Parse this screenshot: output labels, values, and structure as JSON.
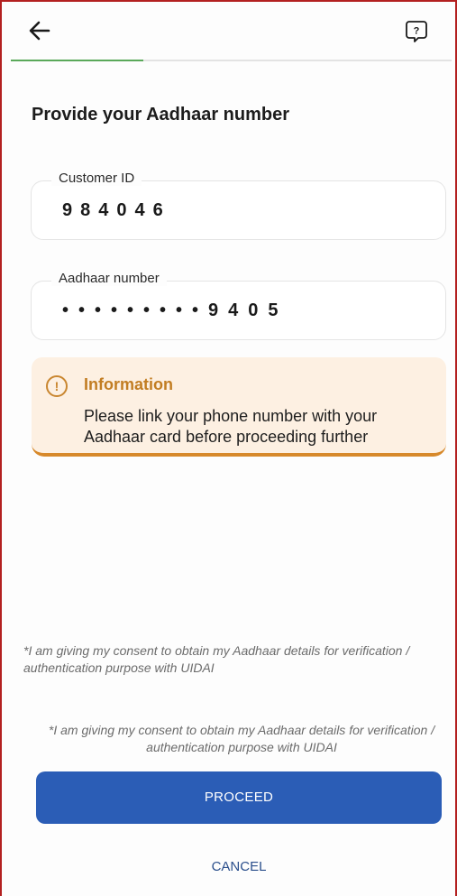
{
  "header": {
    "back_icon": "arrow-left-icon",
    "help_icon": "help-bubble-icon",
    "progress_fraction": 0.3,
    "progress_color": "#5aa95a"
  },
  "page": {
    "title": "Provide your Aadhaar number"
  },
  "customer_id": {
    "label": "Customer ID",
    "value": "984046"
  },
  "aadhaar": {
    "label": "Aadhaar number",
    "value": "•••••••••9405"
  },
  "info": {
    "icon": "exclamation-circle-icon",
    "title": "Information",
    "text": "Please link your phone number with your Aadhaar card before proceeding further",
    "accent_color": "#d7892b"
  },
  "consent": {
    "text_1": "*I am giving my consent to obtain my Aadhaar details for verification / authentication purpose with UIDAI",
    "text_2": "*I am giving my consent to obtain my Aadhaar details for verification / authentication purpose with UIDAI"
  },
  "actions": {
    "proceed_label": "PROCEED",
    "cancel_label": "CANCEL",
    "primary_color": "#2b5db6"
  }
}
